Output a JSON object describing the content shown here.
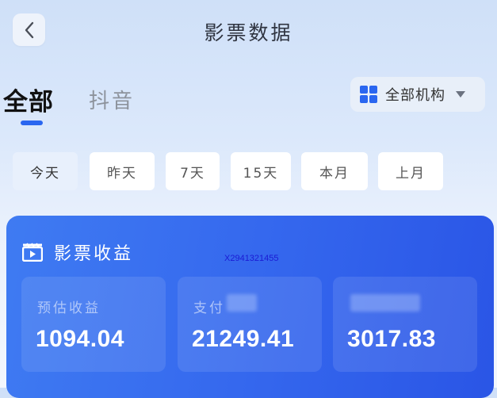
{
  "header": {
    "title": "影票数据"
  },
  "tabs": [
    {
      "label": "全部",
      "active": true
    },
    {
      "label": "抖音",
      "active": false
    }
  ],
  "org_filter": {
    "label": "全部机构"
  },
  "date_filters": [
    {
      "label": "今天",
      "active": true
    },
    {
      "label": "昨天",
      "active": false
    },
    {
      "label": "7天",
      "active": false
    },
    {
      "label": "15天",
      "active": false
    },
    {
      "label": "本月",
      "active": false
    },
    {
      "label": "上月",
      "active": false
    }
  ],
  "card": {
    "title": "影票收益",
    "stats": [
      {
        "label": "预估收益",
        "value": "1094.04"
      },
      {
        "label": "支付",
        "value": "21249.41"
      },
      {
        "label": "",
        "value": "3017.83"
      }
    ]
  },
  "watermark": "X2941321455",
  "colors": {
    "accent": "#2a66f0",
    "card_start": "#3f7bf2",
    "card_end": "#2a55e6"
  }
}
